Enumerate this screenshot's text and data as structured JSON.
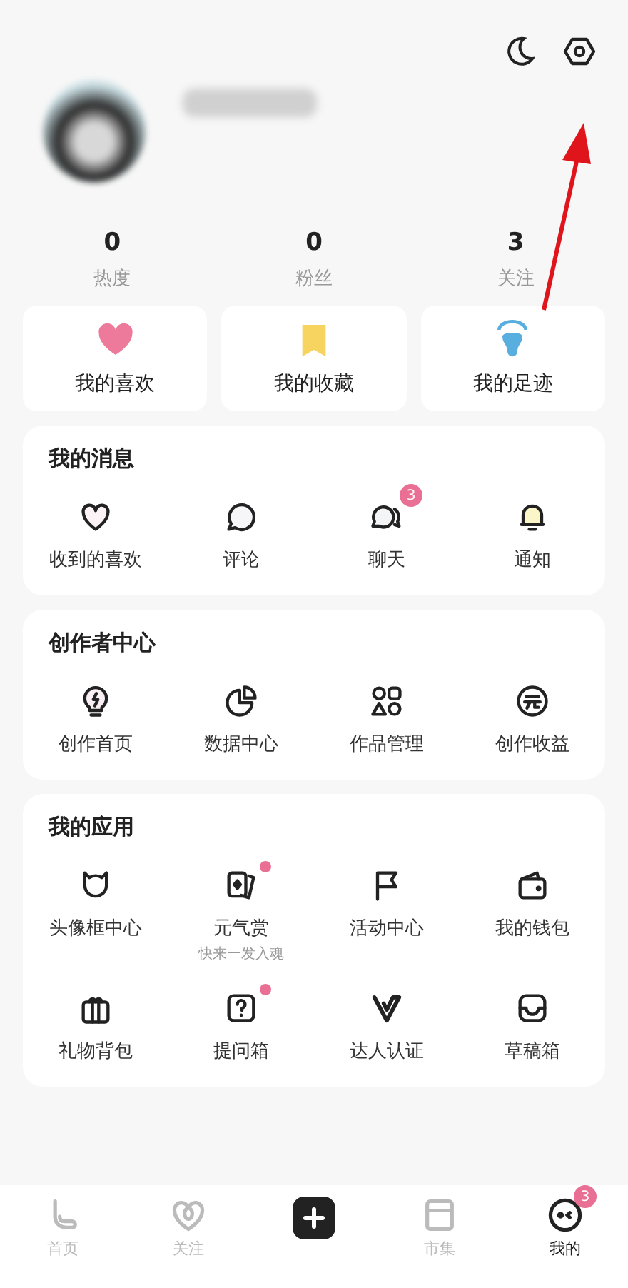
{
  "stats": [
    {
      "value": "0",
      "label": "热度"
    },
    {
      "value": "0",
      "label": "粉丝"
    },
    {
      "value": "3",
      "label": "关注"
    }
  ],
  "shortcuts": [
    {
      "kind": "heart",
      "label": "我的喜欢"
    },
    {
      "kind": "bookmark",
      "label": "我的收藏"
    },
    {
      "kind": "footprint",
      "label": "我的足迹"
    }
  ],
  "sections": [
    {
      "title": "我的消息",
      "items": [
        {
          "kind": "heart",
          "label": "收到的喜欢"
        },
        {
          "kind": "comment",
          "label": "评论"
        },
        {
          "kind": "chat",
          "label": "聊天",
          "badge": "3"
        },
        {
          "kind": "bell",
          "label": "通知"
        }
      ]
    },
    {
      "title": "创作者中心",
      "items": [
        {
          "kind": "bulb",
          "label": "创作首页"
        },
        {
          "kind": "pie",
          "label": "数据中心"
        },
        {
          "kind": "shapes",
          "label": "作品管理"
        },
        {
          "kind": "yuan",
          "label": "创作收益"
        }
      ]
    },
    {
      "title": "我的应用",
      "items": [
        {
          "kind": "cat",
          "label": "头像框中心"
        },
        {
          "kind": "cards",
          "label": "元气赏",
          "dot": true,
          "caption": "快来一发入魂"
        },
        {
          "kind": "flag",
          "label": "活动中心"
        },
        {
          "kind": "wallet",
          "label": "我的钱包"
        },
        {
          "kind": "gift",
          "label": "礼物背包"
        },
        {
          "kind": "question",
          "label": "提问箱",
          "dot": true
        },
        {
          "kind": "v",
          "label": "达人认证"
        },
        {
          "kind": "tray",
          "label": "草稿箱"
        }
      ]
    }
  ],
  "tabs": [
    {
      "kind": "home",
      "label": "首页",
      "selected": false
    },
    {
      "kind": "follow",
      "label": "关注",
      "selected": false
    },
    {
      "kind": "plus"
    },
    {
      "kind": "market",
      "label": "市集",
      "selected": false
    },
    {
      "kind": "me",
      "label": "我的",
      "selected": true,
      "badge": "3"
    }
  ]
}
